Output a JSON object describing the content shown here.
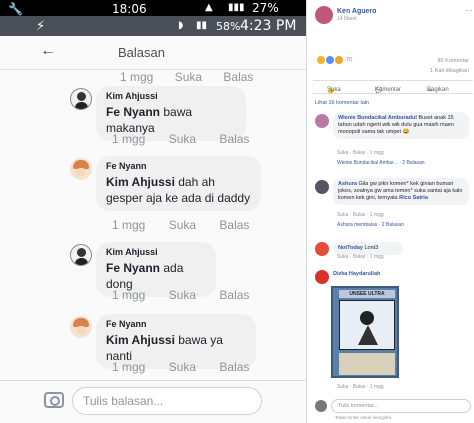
{
  "status_bar_1": {
    "left_icon": "🔧",
    "left_icon2": "",
    "time": "18:06",
    "battery": "27%"
  },
  "status_bar_2": {
    "signal": "58%",
    "time": "4:23 PM"
  },
  "header": {
    "title": "Balasan"
  },
  "thread": {
    "top_meta": [
      "1 mgg",
      "Suka",
      "Balas"
    ],
    "comments": [
      {
        "name": "Kim Ahjussi",
        "mention": "Fe Nyann",
        "text": "bawa makanya",
        "meta": [
          "1 mgg",
          "Suka",
          "Balas"
        ]
      },
      {
        "name": "Fe Nyann",
        "mention": "Kim Ahjussi",
        "text": "dah ah gesper aja ke ada di daddy",
        "meta": [
          "1 mgg",
          "Suka",
          "Balas"
        ]
      },
      {
        "name": "Kim Ahjussi",
        "mention": "Fe Nyann",
        "text": "ada dong",
        "meta": [
          "1 mgg",
          "Suka",
          "Balas"
        ]
      },
      {
        "name": "Fe Nyann",
        "mention": "Kim Ahjussi",
        "text": "bawa ya nanti",
        "meta": [
          "1 mgg",
          "Suka",
          "Balas"
        ]
      }
    ]
  },
  "reply_bar": {
    "placeholder": "Tulis balasan..."
  },
  "post": {
    "author": "Ken Aguero",
    "date": "14 Maret",
    "reaction_count": "70",
    "comment_count": "80 Komentar",
    "share_count": "1 Kali dibagikan",
    "actions": [
      "Suka",
      "Komentar",
      "Bagikan"
    ],
    "more_comments": "Lihat 16 komentar lain",
    "comments": [
      {
        "name": "Wienie Bundacikal Amburadul",
        "text": "Buset anak 15 tahun udah ngerti wik wik dulu gua masih maen monopoli sama tak umpet 😂",
        "meta": "Suka · Balas · 1 mgg",
        "reply": "Wienie Bundacikal Ambur... · 2 Balasan"
      },
      {
        "name": "Ashura",
        "text": "Gila gw pikir komen* kek ginian bumari jokes, soalnya gw ama temen* suka santai aja kalo komen kek gini, ternyata",
        "tail": "Rico Satria",
        "meta": "Suka · Balas · 1 mgg",
        "reply": "Ashura membalas · 2 Balasan"
      },
      {
        "name": "NotToday",
        "text": "Lont3",
        "meta": "Suka · Balas · 1 mgg"
      },
      {
        "name": "Dizka Haydarullah",
        "card_title": "UNSEE ULTRA",
        "meta": "Suka · Balas · 1 mgg"
      }
    ],
    "write_placeholder": "Tulis komentar...",
    "hint": "Tekan Enter untuk mengirim."
  }
}
